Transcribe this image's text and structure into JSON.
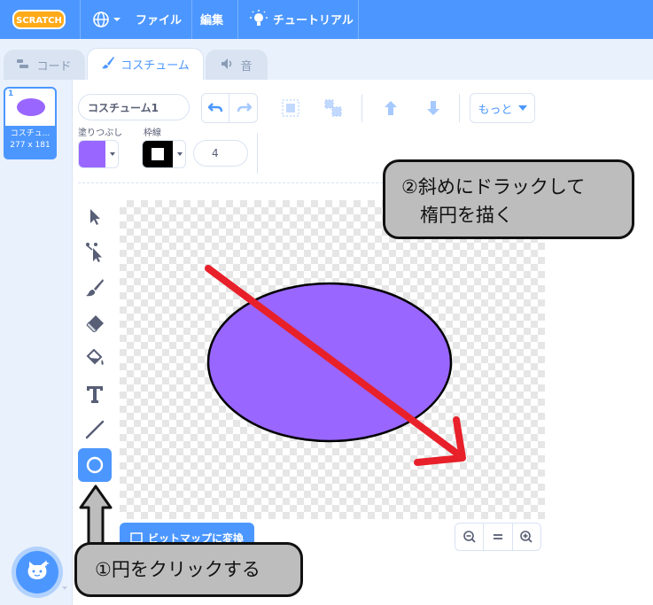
{
  "menubar": {
    "logo": "SCRATCH",
    "file": "ファイル",
    "edit": "編集",
    "tutorials": "チュートリアル"
  },
  "tabs": [
    {
      "label": "コード"
    },
    {
      "label": "コスチューム"
    },
    {
      "label": "音"
    }
  ],
  "costume": {
    "number": "1",
    "name_short": "コスチュ...",
    "size": "277 x 181",
    "fill_color": "#9966ff"
  },
  "toolbar": {
    "name_value": "コスチューム1",
    "fill_label": "塗りつぶし",
    "outline_label": "枠線",
    "outline_width": "4",
    "more_label": "もっと"
  },
  "canvas": {
    "convert_button": "ビットマップに変換"
  },
  "callouts": {
    "step1": "①円をクリックする",
    "step2": "②斜めにドラックして\n　楕円を描く"
  },
  "colors": {
    "accent": "#4c97ff",
    "ellipse_fill": "#9966ff",
    "arrow": "#e8202a",
    "callout_bg": "#bdbdbd"
  }
}
